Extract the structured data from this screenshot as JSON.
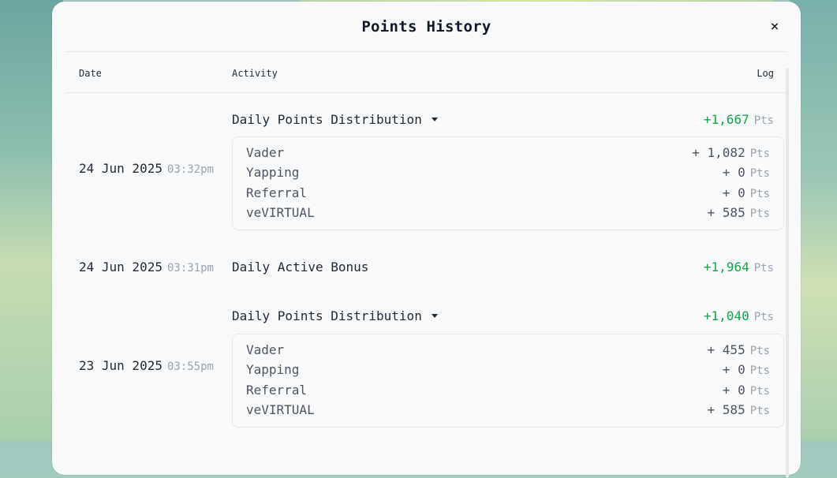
{
  "modal": {
    "title": "Points History",
    "close_label": "×"
  },
  "table": {
    "headers": {
      "date": "Date",
      "activity": "Activity",
      "log": "Log"
    },
    "unit": "Pts",
    "rows": [
      {
        "date": "24 Jun 2025",
        "time": "03:32pm",
        "activity": "Daily Points Distribution",
        "total": "+1,667",
        "expandable": true,
        "breakdown": [
          {
            "label": "Vader",
            "value": "+ 1,082"
          },
          {
            "label": "Yapping",
            "value": "+ 0"
          },
          {
            "label": "Referral",
            "value": "+ 0"
          },
          {
            "label": "veVIRTUAL",
            "value": "+ 585"
          }
        ]
      },
      {
        "date": "24 Jun 2025",
        "time": "03:31pm",
        "activity": "Daily Active Bonus",
        "total": "+1,964",
        "expandable": false
      },
      {
        "date": "23 Jun 2025",
        "time": "03:55pm",
        "activity": "Daily Points Distribution",
        "total": "+1,040",
        "expandable": true,
        "breakdown": [
          {
            "label": "Vader",
            "value": "+ 455"
          },
          {
            "label": "Yapping",
            "value": "+ 0"
          },
          {
            "label": "Referral",
            "value": "+ 0"
          },
          {
            "label": "veVIRTUAL",
            "value": "+ 585"
          }
        ]
      }
    ]
  },
  "colors": {
    "positive": "#16a34a",
    "muted": "#9ca3af",
    "text": "#1f2937"
  }
}
